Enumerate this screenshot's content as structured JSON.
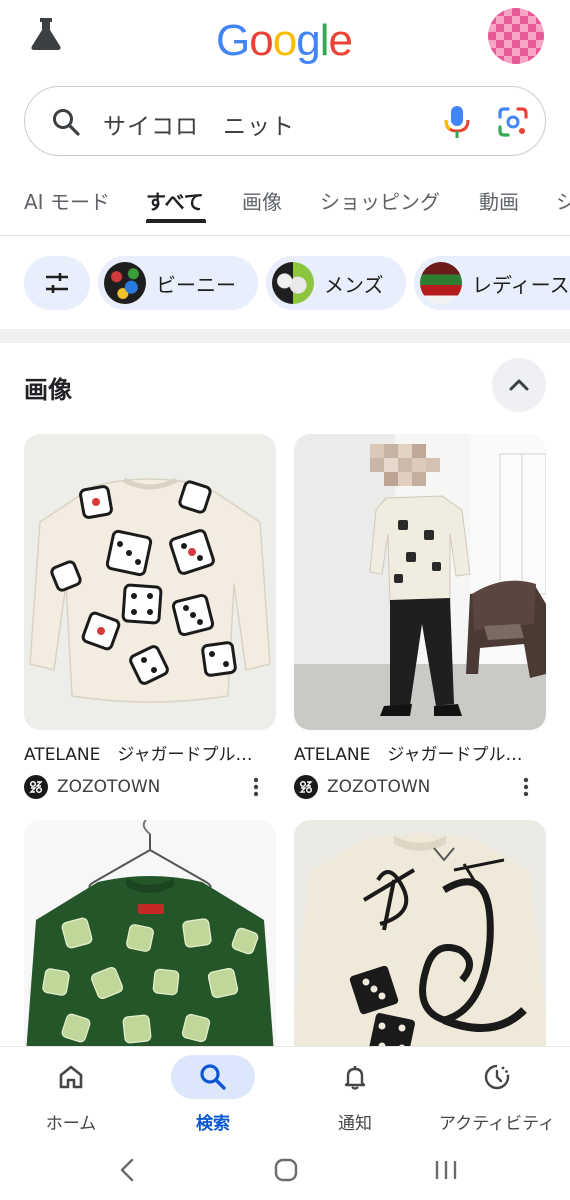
{
  "header": {
    "logo_letters": [
      {
        "char": "G",
        "color": "#4285F4"
      },
      {
        "char": "o",
        "color": "#EA4335"
      },
      {
        "char": "o",
        "color": "#FBBC05"
      },
      {
        "char": "g",
        "color": "#4285F4"
      },
      {
        "char": "l",
        "color": "#34A853"
      },
      {
        "char": "e",
        "color": "#EA4335"
      }
    ],
    "labs_icon": "flask-icon",
    "avatar_icon": "avatar"
  },
  "search": {
    "query": "サイコロ　ニット",
    "icons": [
      "search-icon",
      "mic-icon",
      "lens-icon"
    ]
  },
  "tabs": [
    {
      "label": "AI モード",
      "active": false
    },
    {
      "label": "すべて",
      "active": true
    },
    {
      "label": "画像",
      "active": false
    },
    {
      "label": "ショッピング",
      "active": false
    },
    {
      "label": "動画",
      "active": false
    },
    {
      "label": "シ",
      "active": false
    }
  ],
  "chips": [
    {
      "label": "ビーニー"
    },
    {
      "label": "メンズ"
    },
    {
      "label": "レディース"
    }
  ],
  "images_section": {
    "title": "画像",
    "cards": [
      {
        "title": "ATELANE　ジャガードプル…",
        "source": "ZOZOTOWN"
      },
      {
        "title": "ATELANE　ジャガードプル…",
        "source": "ZOZOTOWN"
      },
      {
        "title": "",
        "source": ""
      },
      {
        "title": "",
        "source": ""
      }
    ]
  },
  "bottom_nav": [
    {
      "label": "ホーム",
      "icon": "home-icon",
      "active": false
    },
    {
      "label": "検索",
      "icon": "search-icon",
      "active": true
    },
    {
      "label": "通知",
      "icon": "bell-icon",
      "active": false
    },
    {
      "label": "アクティビティ",
      "icon": "activity-icon",
      "active": false
    }
  ],
  "colors": {
    "accent": "#0b57d0",
    "chip_bg": "#e8eefb",
    "nav_active_bg": "#dce7fb"
  }
}
